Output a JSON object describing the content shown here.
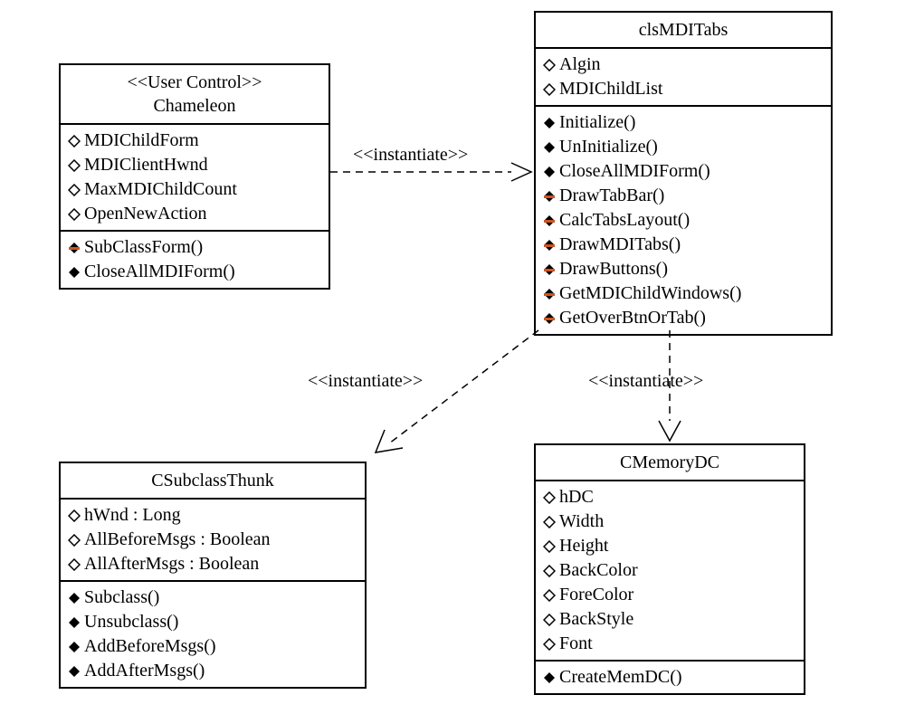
{
  "classes": {
    "chameleon": {
      "stereotype": "<<User Control>>",
      "name": "Chameleon",
      "attributes": [
        "MDIChildForm",
        "MDIClientHwnd",
        "MaxMDIChildCount",
        "OpenNewAction"
      ],
      "operations": [
        {
          "name": "SubClassForm()",
          "vis": "private"
        },
        {
          "name": "CloseAllMDIForm()",
          "vis": "public"
        }
      ]
    },
    "clsMDITabs": {
      "name": "clsMDITabs",
      "attributes": [
        "Algin",
        "MDIChildList"
      ],
      "operations": [
        {
          "name": "Initialize()",
          "vis": "public"
        },
        {
          "name": "UnInitialize()",
          "vis": "public"
        },
        {
          "name": "CloseAllMDIForm()",
          "vis": "public"
        },
        {
          "name": "DrawTabBar()",
          "vis": "private"
        },
        {
          "name": "CalcTabsLayout()",
          "vis": "private"
        },
        {
          "name": "DrawMDITabs()",
          "vis": "private"
        },
        {
          "name": "DrawButtons()",
          "vis": "private"
        },
        {
          "name": "GetMDIChildWindows()",
          "vis": "private"
        },
        {
          "name": "GetOverBtnOrTab()",
          "vis": "private"
        }
      ]
    },
    "csubclassThunk": {
      "name": "CSubclassThunk",
      "attributes": [
        "hWnd : Long",
        "AllBeforeMsgs : Boolean",
        "AllAfterMsgs : Boolean"
      ],
      "operations": [
        {
          "name": "Subclass()",
          "vis": "public"
        },
        {
          "name": "Unsubclass()",
          "vis": "public"
        },
        {
          "name": "AddBeforeMsgs()",
          "vis": "public"
        },
        {
          "name": "AddAfterMsgs()",
          "vis": "public"
        }
      ]
    },
    "cMemoryDC": {
      "name": "CMemoryDC",
      "attributes": [
        "hDC",
        "Width",
        "Height",
        "BackColor",
        "ForeColor",
        "BackStyle",
        "Font"
      ],
      "operations": [
        {
          "name": "CreateMemDC()",
          "vis": "public"
        }
      ]
    }
  },
  "relationships": {
    "r1": {
      "label": "<<instantiate>>"
    },
    "r2": {
      "label": "<<instantiate>>"
    },
    "r3": {
      "label": "<<instantiate>>"
    }
  }
}
